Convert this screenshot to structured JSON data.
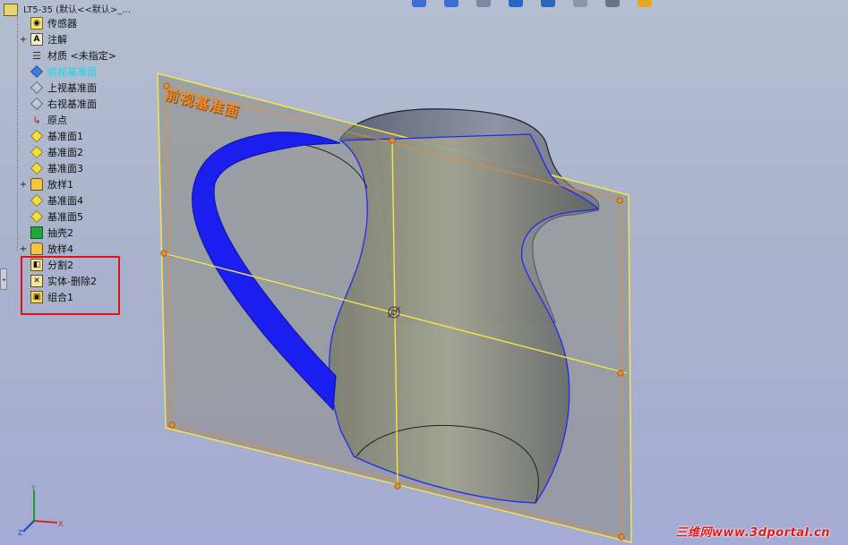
{
  "tree": {
    "root_label": "LT5-35  (默认<<默认>_...",
    "items": [
      {
        "label": "传感器",
        "icon": "sensor-icon",
        "expandable": false
      },
      {
        "label": "注解",
        "icon": "annotation-icon",
        "expandable": true
      },
      {
        "label": "材质 <未指定>",
        "icon": "material-icon",
        "expandable": false
      },
      {
        "label": "前视基准面",
        "icon": "front-plane-icon",
        "expandable": false,
        "selected": true
      },
      {
        "label": "上视基准面",
        "icon": "top-plane-icon",
        "expandable": false
      },
      {
        "label": "右视基准面",
        "icon": "right-plane-icon",
        "expandable": false
      },
      {
        "label": "原点",
        "icon": "origin-icon",
        "expandable": false
      },
      {
        "label": "基准面1",
        "icon": "plane-icon",
        "expandable": false
      },
      {
        "label": "基准面2",
        "icon": "plane-icon",
        "expandable": false
      },
      {
        "label": "基准面3",
        "icon": "plane-icon",
        "expandable": false
      },
      {
        "label": "放样1",
        "icon": "loft-icon",
        "expandable": true
      },
      {
        "label": "基准面4",
        "icon": "plane-icon",
        "expandable": false
      },
      {
        "label": "基准面5",
        "icon": "plane-icon",
        "expandable": false
      },
      {
        "label": "抽壳2",
        "icon": "shell-icon",
        "expandable": false
      },
      {
        "label": "放样4",
        "icon": "loft-icon",
        "expandable": true
      },
      {
        "label": "分割2",
        "icon": "split-icon",
        "expandable": false
      },
      {
        "label": "实体-删除2",
        "icon": "body-delete-icon",
        "expandable": false
      },
      {
        "label": "组合1",
        "icon": "combine-icon",
        "expandable": false
      }
    ]
  },
  "viewport": {
    "plane_label": "前视基准面",
    "watermark": "三维网www.3dportal.cn",
    "triad": {
      "x": "X",
      "y": "Y",
      "z": "Z"
    }
  },
  "colors": {
    "highlight_box": "#e0121a",
    "plane_border": "#f6e44a",
    "plane_handles": "#ee8b2a",
    "handle_blue": "#1a22f2",
    "selected_text": "#19d7e8"
  }
}
